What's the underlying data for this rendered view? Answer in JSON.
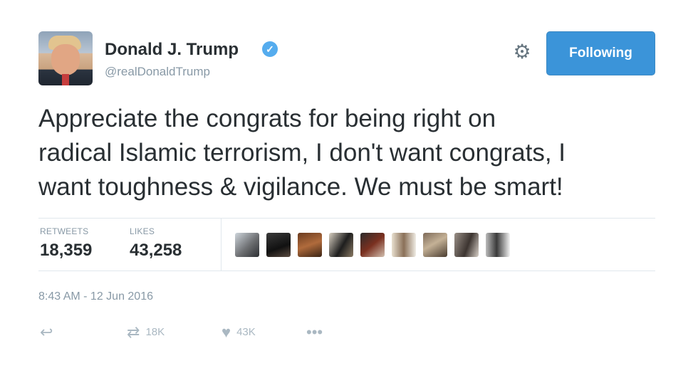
{
  "user": {
    "name": "Donald J. Trump",
    "handle": "@realDonaldTrump",
    "verified_mark": "✓"
  },
  "header": {
    "follow_label": "Following",
    "gear_icon": "gear-icon"
  },
  "tweet": {
    "lines": [
      "Appreciate the congrats for being right on",
      "radical Islamic terrorism, I don't want congrats, I",
      "want toughness & vigilance. We must be smart!"
    ]
  },
  "stats": {
    "retweets_label": "RETWEETS",
    "retweets_value": "18,359",
    "likes_label": "LIKES",
    "likes_value": "43,258"
  },
  "timestamp": "8:43 AM - 12 Jun 2016",
  "actions": {
    "reply_icon": "reply-icon",
    "retweet_count": "18K",
    "like_count": "43K",
    "more_icon": "more-icon"
  },
  "colors": {
    "accent": "#55acee",
    "follow_button": "#3b94d9",
    "text": "#292f33",
    "muted": "#8899a6",
    "divider": "#e1e8ed"
  }
}
